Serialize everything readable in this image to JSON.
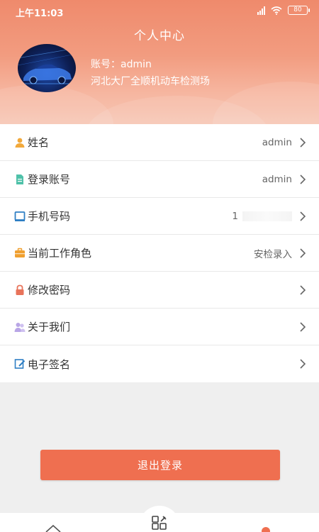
{
  "status_bar": {
    "time": "上午11:03",
    "battery": "80"
  },
  "header": {
    "title": "个人中心",
    "account_label": "账号：admin",
    "company": "河北大厂全顺机动车检测场"
  },
  "menu": {
    "items": [
      {
        "label": "姓名",
        "value": "admin",
        "icon": "person-icon"
      },
      {
        "label": "登录账号",
        "value": "admin",
        "icon": "document-icon"
      },
      {
        "label": "手机号码",
        "value": "1",
        "icon": "phone-icon"
      },
      {
        "label": "当前工作角色",
        "value": "安检录入",
        "icon": "briefcase-icon"
      },
      {
        "label": "修改密码",
        "value": "",
        "icon": "lock-icon"
      },
      {
        "label": "关于我们",
        "value": "",
        "icon": "people-icon"
      },
      {
        "label": "电子签名",
        "value": "",
        "icon": "signature-icon"
      }
    ]
  },
  "logout": {
    "label": "退出登录"
  },
  "colors": {
    "accent": "#ef6f50",
    "header_top": "#ef8a6c",
    "header_bottom": "#f7c6b4"
  }
}
